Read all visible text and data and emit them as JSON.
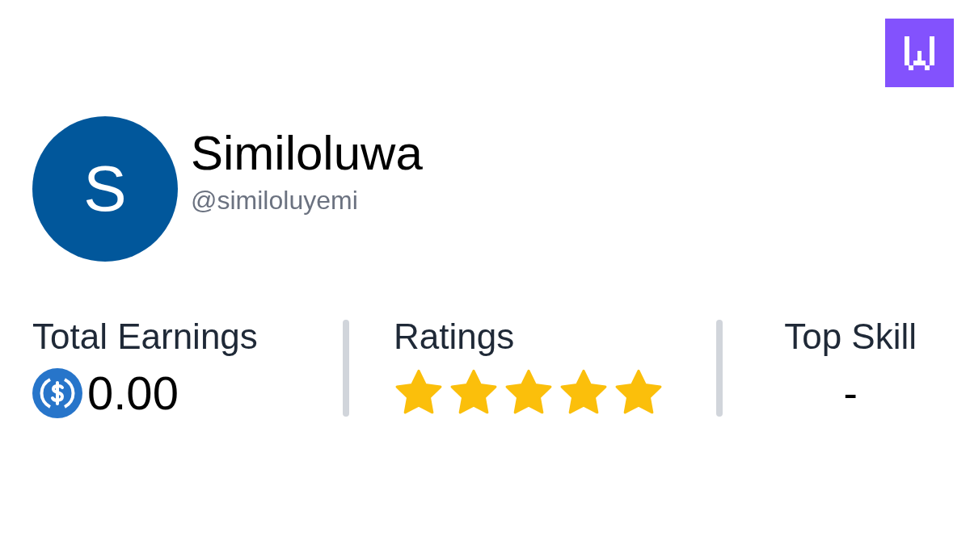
{
  "profile": {
    "initial": "S",
    "name": "Similoluwa",
    "handle": "@similoluyemi"
  },
  "stats": {
    "earnings": {
      "label": "Total Earnings",
      "value": "0.00"
    },
    "ratings": {
      "label": "Ratings",
      "stars": 5
    },
    "top_skill": {
      "label": "Top Skill",
      "value": "-"
    }
  }
}
